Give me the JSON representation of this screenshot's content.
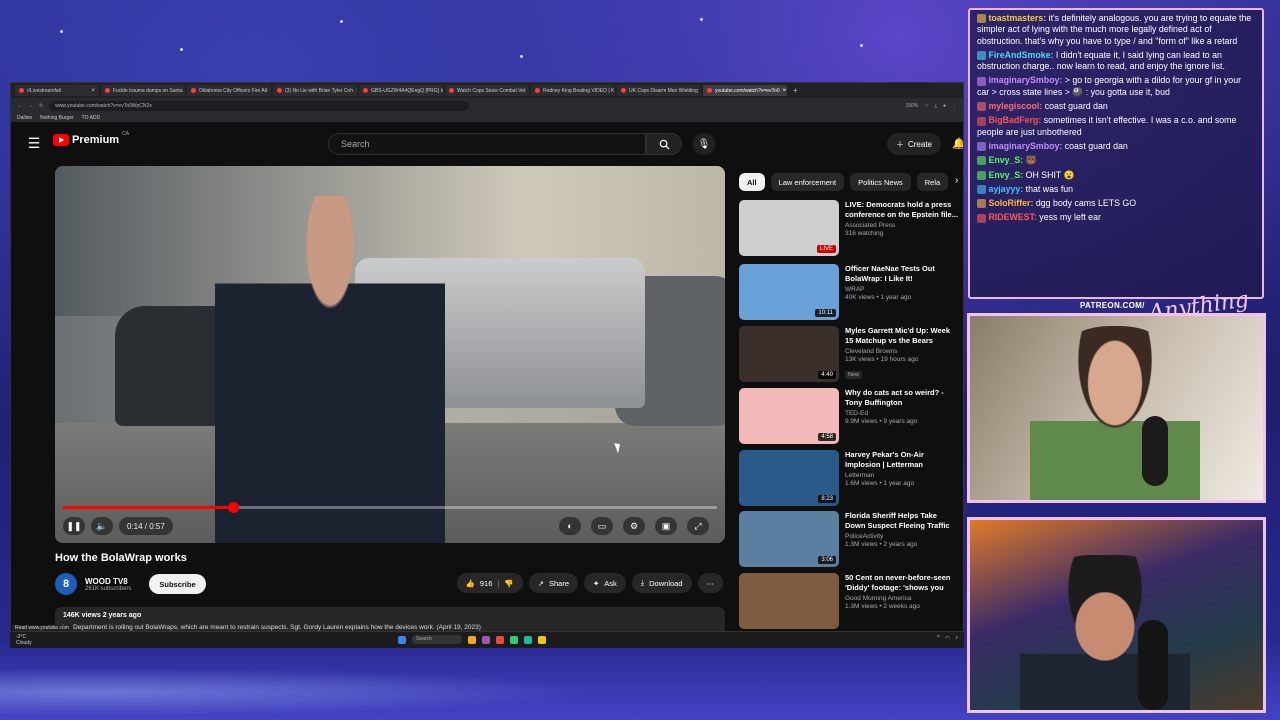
{
  "browser": {
    "tabs": [
      {
        "label": "r/Livestreamfail"
      },
      {
        "label": "Fuckle trauma dumps on Santa"
      },
      {
        "label": "Oklahoma City Officers Fire Alt"
      },
      {
        "label": "(3) No Lie with Brian Tyler Coh"
      },
      {
        "label": "GBS-UGZW4A4QEngQ [PRG] In"
      },
      {
        "label": "Watch Cops Seize Combat Vet"
      },
      {
        "label": "Rodney King Beating VIDEO | K"
      },
      {
        "label": "UK Cops Disarm Man Wielding"
      },
      {
        "label": "youtube.com/watch?v=evTo0"
      }
    ],
    "address": "www.youtube.com/watch?v=evTo0WpCN2e",
    "zoom": "150%",
    "bookmarks": [
      "Dailies",
      "Nothing Burger",
      "TO ADD"
    ]
  },
  "youtube": {
    "logo_text": "Premium",
    "logo_region": "CA",
    "search_placeholder": "Search",
    "create_label": "Create",
    "video": {
      "title": "How the BolaWrap works",
      "time": "0:14 / 0:57",
      "progress": 0.26,
      "channel_initial": "8",
      "channel_name": "WOOD TV8",
      "channel_subs": "261K subscribers",
      "subscribe_label": "Subscribe",
      "likes": "916",
      "share_label": "Share",
      "ask_label": "Ask",
      "download_label": "Download",
      "views_date": "146K views  2 years ago",
      "description": "ice Department is rolling out BolaWraps, which are meant to restrain suspects. Sgt. Gordy Lauren explains how the devices work. (April 19, 2023)"
    },
    "chips": [
      "All",
      "Law enforcement",
      "Politics News",
      "Rela"
    ],
    "recommendations": [
      {
        "title": "LIVE: Democrats hold a press conference on the Epstein file...",
        "channel": "Associated Press",
        "meta": "316 watching",
        "duration": "LIVE",
        "color": "#cfcfcf"
      },
      {
        "title": "Officer NaeNae Tests Out BolaWrap: I Like It!",
        "channel": "WRAP",
        "meta": "40K views • 1 year ago",
        "duration": "10:11",
        "color": "#6aa0d8"
      },
      {
        "title": "Myles Garrett Mic'd Up: Week 15 Matchup vs the Bears",
        "channel": "Cleveland Browns",
        "meta": "13K views • 19 hours ago",
        "duration": "4:40",
        "color": "#3a2f2a",
        "badge": "New"
      },
      {
        "title": "Why do cats act so weird? - Tony Buffington",
        "channel": "TED-Ed",
        "meta": "9.9M views • 9 years ago",
        "duration": "4:58",
        "color": "#f1b9b9"
      },
      {
        "title": "Harvey Pekar's On-Air Implosion | Letterman",
        "channel": "Letterman",
        "meta": "1.6M views • 1 year ago",
        "duration": "8:23",
        "color": "#2a5a8a"
      },
      {
        "title": "Florida Sheriff Helps Take Down Suspect Fleeing Traffic Stop",
        "channel": "PoliceActivity",
        "meta": "1.3M views • 2 years ago",
        "duration": "3:06",
        "color": "#5b7fa0"
      },
      {
        "title": "50 Cent on never-before-seen 'Diddy' footage: 'shows you his...",
        "channel": "Good Morning America",
        "meta": "1.3M views • 2 weeks ago",
        "duration": "",
        "color": "#7d5a40"
      }
    ]
  },
  "taskbar": {
    "weather_temp": "-3°C",
    "weather_desc": "Cloudy",
    "search": "Search",
    "status_url": "Read www.youtube.com"
  },
  "chat": {
    "messages": [
      {
        "user": "toastmasters:",
        "color": "#f7c948",
        "text": "it's definitely analogous. you are trying to equate the simpler act of lying with the much more legally defined act of obstruction. that's why you have to type / and \"form of\" like a retard"
      },
      {
        "user": "FireAndSmoke:",
        "color": "#4bd9f5",
        "text": "I didn't equate it, I said lying can lead to an obstruction charge.. now learn to read, and enjoy the ignore list."
      },
      {
        "user": "imaginarySmboy:",
        "color": "#c58bff",
        "text": "> go to georgia with a dildo for your gf in your car > cross state lines > 🎱 : you gotta use it, bud"
      },
      {
        "user": "mylegiscool:",
        "color": "#ff6b6b",
        "text": "coast guard dan"
      },
      {
        "user": "BigBadFerg:",
        "color": "#ff5151",
        "text": "sometimes it isn't effective. I was a c.o. and some people are just unbothered"
      },
      {
        "user": "imaginarySmboy:",
        "color": "#c58bff",
        "text": "coast guard dan"
      },
      {
        "user": "Envy_S:",
        "color": "#5cf55c",
        "text": "🐻"
      },
      {
        "user": "Envy_S:",
        "color": "#5cf55c",
        "text": "OH SHIT 😮"
      },
      {
        "user": "ayjayyy:",
        "color": "#49c0ff",
        "text": "that was fun"
      },
      {
        "user": "SoloRiffer:",
        "color": "#ffb347",
        "text": "dgg body cams LETS GO"
      },
      {
        "user": "RIDEWEST:",
        "color": "#ff5a5a",
        "text": "yess my left ear"
      }
    ]
  },
  "overlay": {
    "patreon": "PATREON.COM/",
    "signature": "Anything Bebe"
  }
}
